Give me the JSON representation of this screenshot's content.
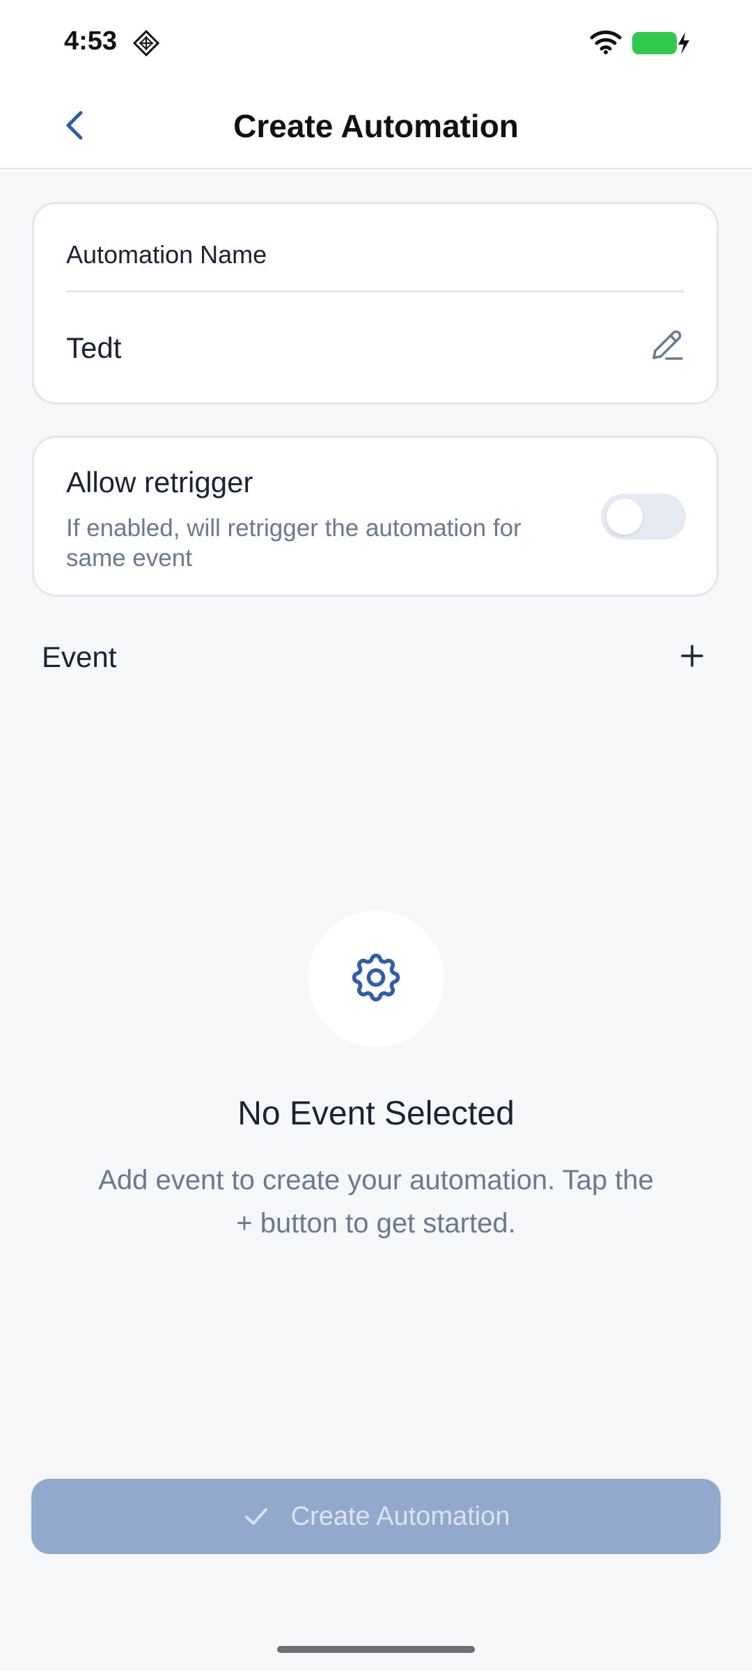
{
  "status_bar": {
    "time": "4:53",
    "icons": [
      "diamond-app-icon",
      "wifi-icon",
      "battery-charging-icon"
    ],
    "battery_color": "#30c94e"
  },
  "header": {
    "title": "Create Automation",
    "back_icon": "chevron-left-icon"
  },
  "name_card": {
    "label": "Automation Name",
    "value": "Tedt",
    "edit_icon": "pencil-icon"
  },
  "retrigger_card": {
    "title": "Allow retrigger",
    "description": "If enabled, will retrigger the automation for same event",
    "enabled": false
  },
  "event_section": {
    "label": "Event",
    "add_icon": "plus-icon"
  },
  "empty_state": {
    "icon": "gear-icon",
    "title": "No Event Selected",
    "description": "Add event to create your automation. Tap the + button to get started."
  },
  "footer": {
    "button_label": "Create Automation",
    "button_icon": "check-icon",
    "disabled": true
  },
  "colors": {
    "accent": "#2f5ea8",
    "button_disabled": "#92a9cd",
    "muted_text": "#6a7890"
  }
}
